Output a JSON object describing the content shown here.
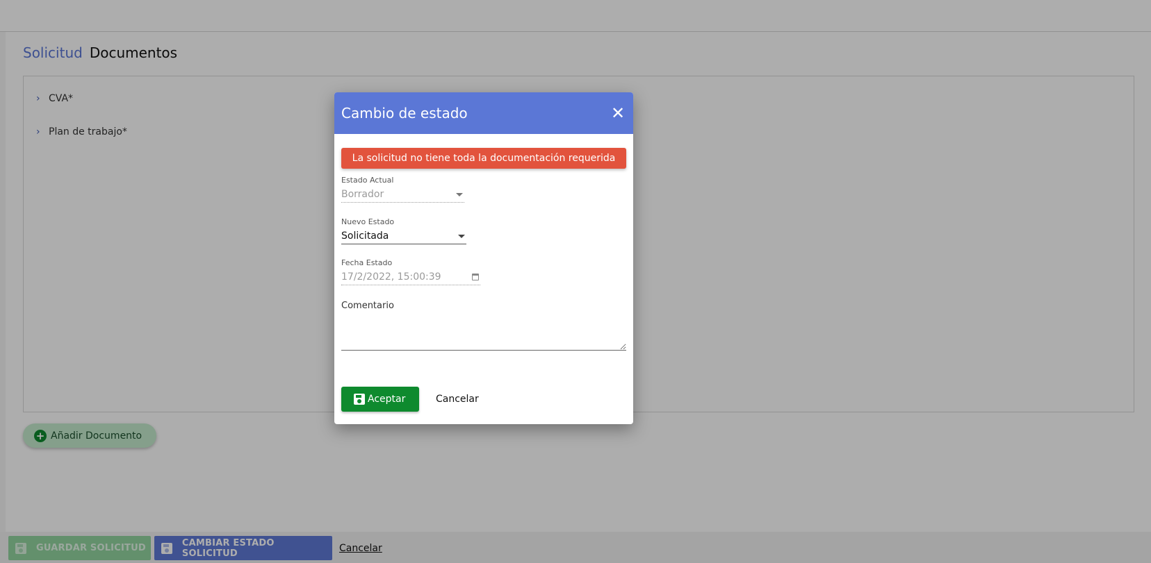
{
  "page": {
    "tabs": [
      {
        "label": "Solicitud"
      },
      {
        "label": "Documentos"
      }
    ],
    "documents": [
      {
        "label": "CVA*"
      },
      {
        "label": "Plan de trabajo*"
      }
    ],
    "add_document_label": "Añadir Documento",
    "footer": {
      "save_label": "GUARDAR SOLICITUD",
      "change_state_label": "CAMBIAR ESTADO SOLICITUD",
      "cancel_label": "Cancelar"
    }
  },
  "dialog": {
    "title": "Cambio de estado",
    "close_icon": "close-icon",
    "alert": "La solicitud no tiene toda la documentación requerida",
    "current_state": {
      "label": "Estado Actual",
      "value": "Borrador"
    },
    "new_state": {
      "label": "Nuevo Estado",
      "value": "Solicitada"
    },
    "state_date": {
      "label": "Fecha Estado",
      "value": "17/2/2022, 15:00:39"
    },
    "comment": {
      "label": "Comentario",
      "value": ""
    },
    "accept_label": "Aceptar",
    "cancel_label": "Cancelar"
  },
  "colors": {
    "header_blue": "#5b77d6",
    "alert_red": "#e2533d",
    "accept_green": "#0e8a2e"
  }
}
